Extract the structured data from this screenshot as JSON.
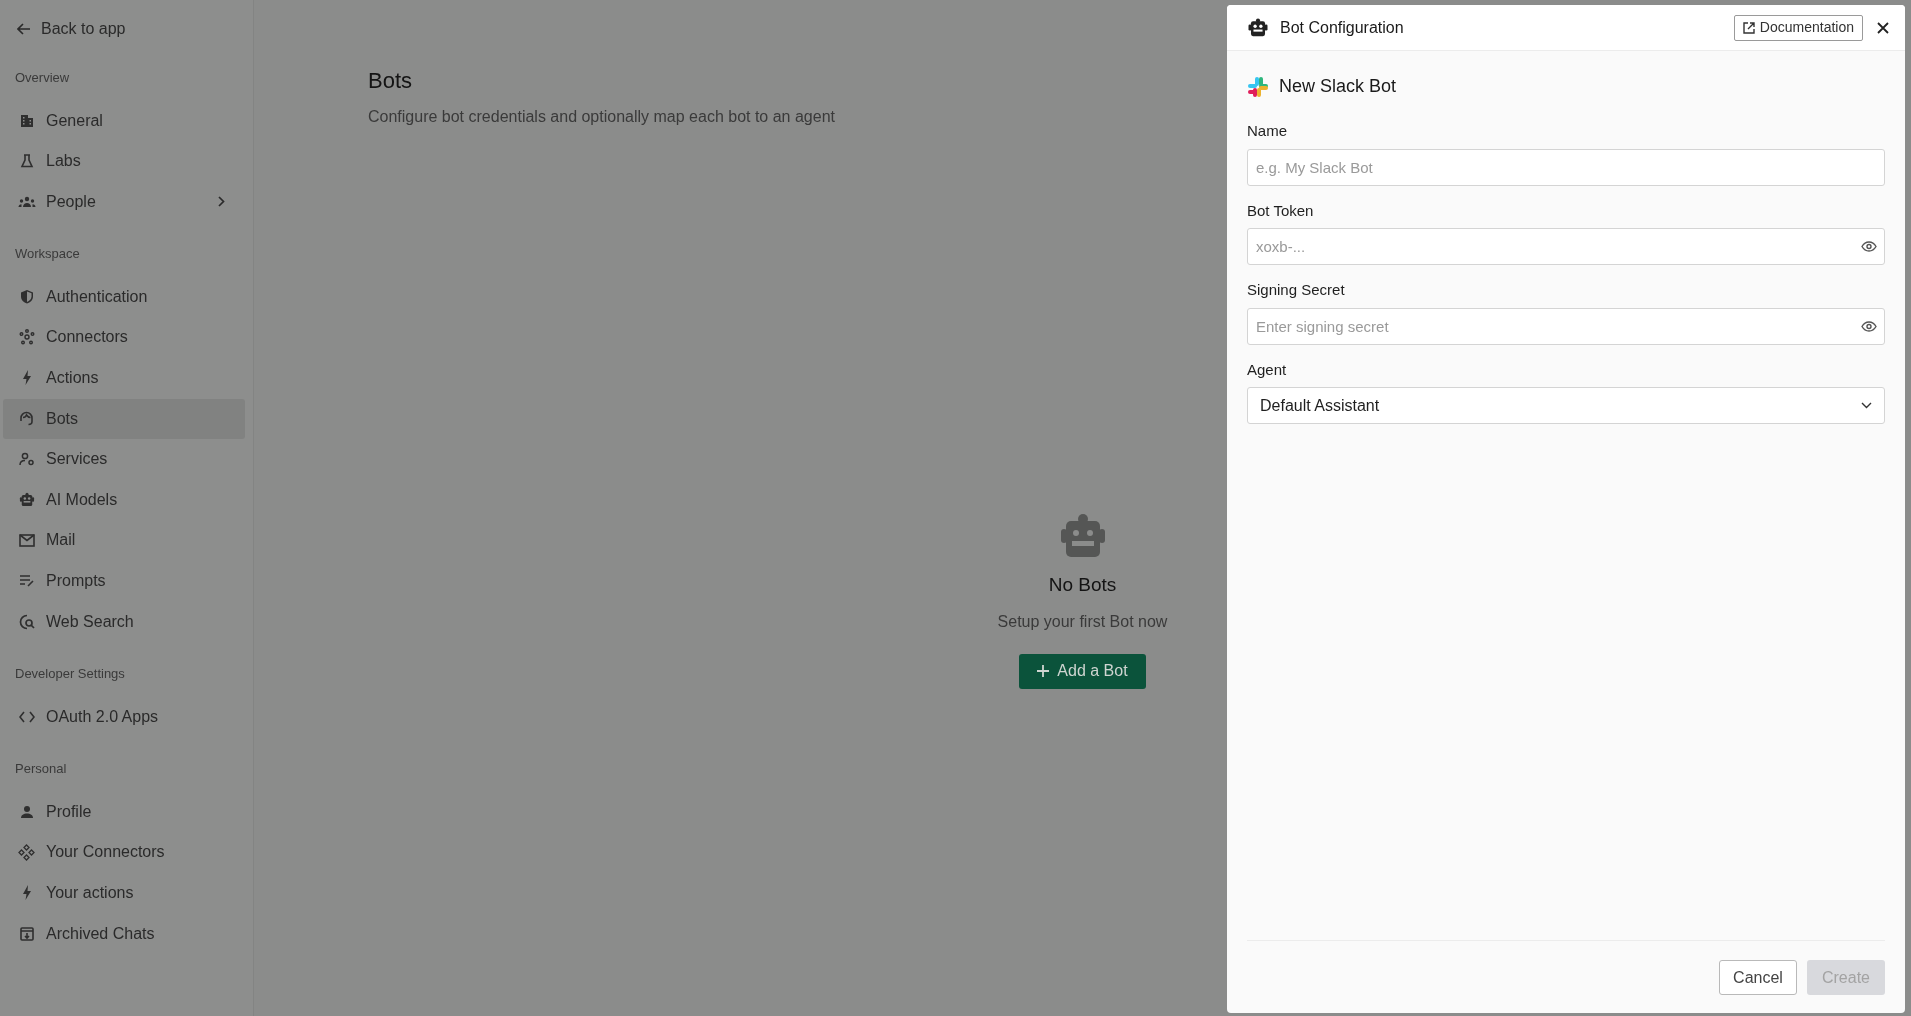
{
  "sidebar": {
    "back_link": "Back to app",
    "sections": [
      {
        "label": "Overview",
        "items": [
          {
            "label": "General",
            "selected": false,
            "expandable": false
          },
          {
            "label": "Labs",
            "selected": false,
            "expandable": false
          },
          {
            "label": "People",
            "selected": false,
            "expandable": true
          }
        ]
      },
      {
        "label": "Workspace",
        "items": [
          {
            "label": "Authentication",
            "selected": false,
            "expandable": false
          },
          {
            "label": "Connectors",
            "selected": false,
            "expandable": false
          },
          {
            "label": "Actions",
            "selected": false,
            "expandable": false
          },
          {
            "label": "Bots",
            "selected": true,
            "expandable": false
          },
          {
            "label": "Services",
            "selected": false,
            "expandable": false
          },
          {
            "label": "AI Models",
            "selected": false,
            "expandable": false
          },
          {
            "label": "Mail",
            "selected": false,
            "expandable": false
          },
          {
            "label": "Prompts",
            "selected": false,
            "expandable": false
          },
          {
            "label": "Web Search",
            "selected": false,
            "expandable": false
          }
        ]
      },
      {
        "label": "Developer Settings",
        "items": [
          {
            "label": "OAuth 2.0 Apps",
            "selected": false,
            "expandable": false
          }
        ]
      },
      {
        "label": "Personal",
        "items": [
          {
            "label": "Profile",
            "selected": false,
            "expandable": false
          },
          {
            "label": "Your Connectors",
            "selected": false,
            "expandable": false
          },
          {
            "label": "Your actions",
            "selected": false,
            "expandable": false
          },
          {
            "label": "Archived Chats",
            "selected": false,
            "expandable": false
          }
        ]
      }
    ]
  },
  "page": {
    "title": "Bots",
    "subtitle": "Configure bot credentials and optionally map each bot to an agent"
  },
  "empty_state": {
    "title": "No Bots",
    "message": "Setup your first Bot now",
    "button": "Add a Bot"
  },
  "drawer": {
    "title": "Bot Configuration",
    "doc_button": "Documentation",
    "subtitle": "New Slack Bot",
    "fields": [
      {
        "kind": "text",
        "label": "Name",
        "placeholder": "e.g. My Slack Bot"
      },
      {
        "kind": "secret",
        "label": "Bot Token",
        "placeholder": "xoxb-..."
      },
      {
        "kind": "secret",
        "label": "Signing Secret",
        "placeholder": "Enter signing secret"
      },
      {
        "kind": "select",
        "label": "Agent",
        "value": "Default Assistant"
      }
    ],
    "buttons": [
      {
        "label": "Cancel",
        "disabled": false
      },
      {
        "label": "Create",
        "disabled": true
      }
    ]
  }
}
